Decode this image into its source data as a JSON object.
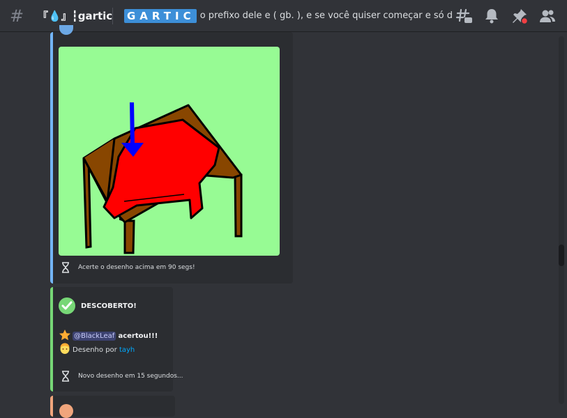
{
  "header": {
    "channel_name": "『💧』┇gartic",
    "topic_logo": "GARTIC",
    "topic_text": "o prefixo dele e ( gb. ), e se você quiser começar e só dar..."
  },
  "toolbar": {
    "threads_icon": "threads-icon",
    "notifications_icon": "bell-icon",
    "pins_icon": "pin-icon",
    "members_icon": "members-icon"
  },
  "drawing_embed": {
    "accent_color": "#73b5f8",
    "footer_icon": "hourglass-icon",
    "footer_text": "Acerte o desenho acima em 90 segs!"
  },
  "result_embed": {
    "accent_color": "#77d776",
    "title_icon": "check-icon",
    "title": "DESCOBERTO!",
    "winner_mention": "@BlackLeaf",
    "winner_suffix": "acertou!!!",
    "drawer_prefix": "Desenho por",
    "drawer_name": "tayh",
    "footer_text": "Novo desenho em 15 segundos..."
  },
  "next_embed": {
    "accent_color": "#f0a57c"
  },
  "colors": {
    "background": "#313338",
    "embed_bg": "#2b2d31",
    "canvas_bg": "#97fb94"
  }
}
